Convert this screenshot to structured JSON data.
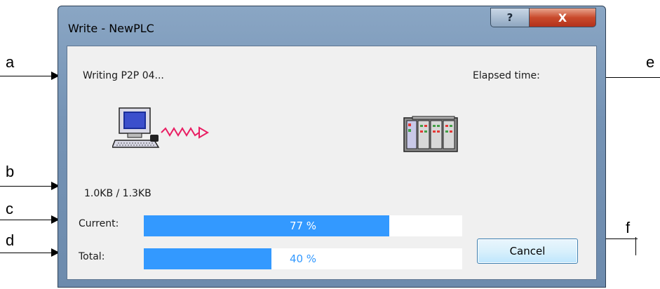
{
  "callouts": {
    "a": "a",
    "b": "b",
    "c": "c",
    "d": "d",
    "e": "e",
    "f": "f"
  },
  "dialog": {
    "title": "Write - NewPLC",
    "help_label": "?",
    "close_label": "X",
    "status_text": "Writing P2P 04...",
    "elapsed_label": "Elapsed time:",
    "size_text": "1.0KB / 1.3KB",
    "current_label": "Current:",
    "current_percent_text": "77 %",
    "current_progress": 0.77,
    "total_label": "Total:",
    "total_percent_text": "40 %",
    "total_progress": 0.4,
    "cancel_label": "Cancel",
    "icons": [
      "computer-icon",
      "signal-arrow-icon",
      "plc-device-icon"
    ]
  },
  "colors": {
    "progress_fill": "#3399ff",
    "client_bg": "#f0f0f0",
    "frame": "#7593b5"
  }
}
